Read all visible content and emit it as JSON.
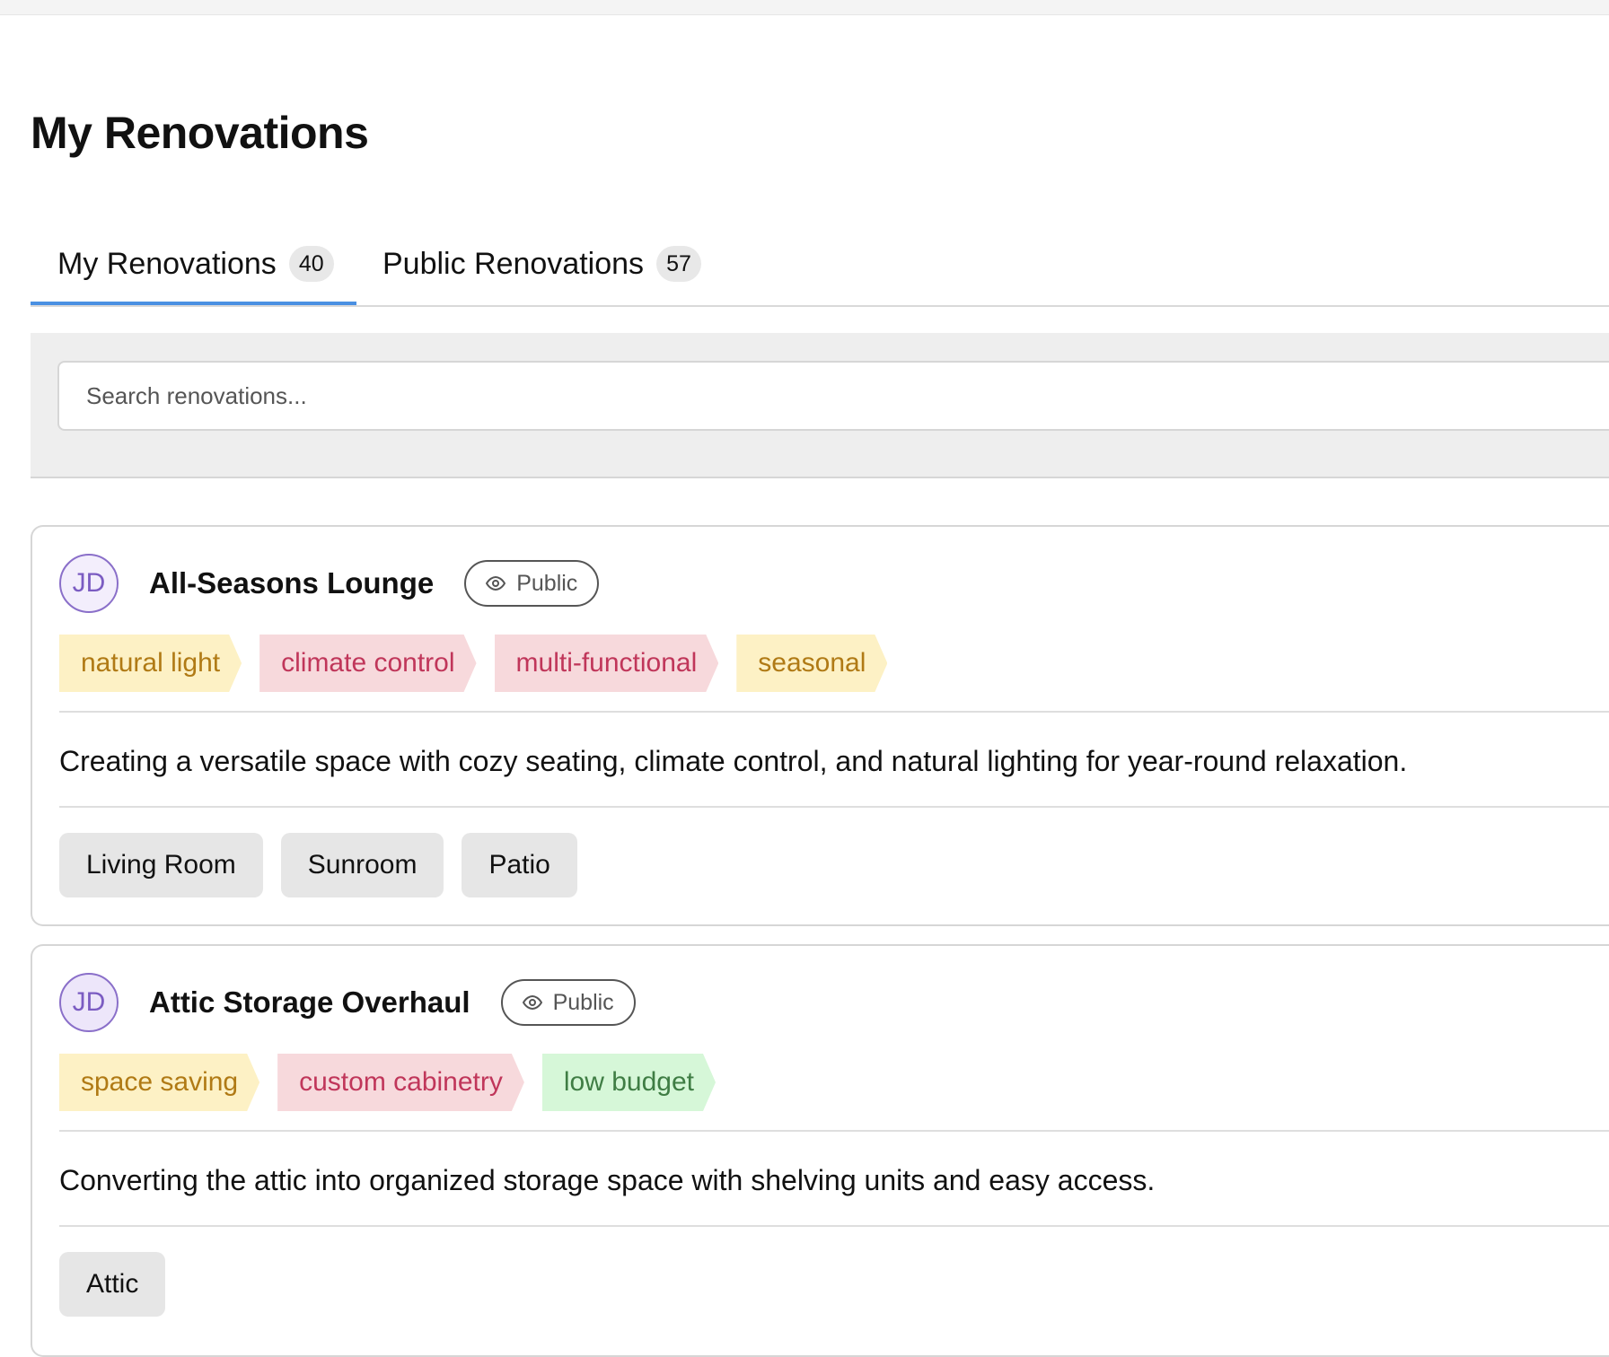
{
  "page": {
    "title": "My Renovations"
  },
  "tabs": [
    {
      "label": "My Renovations",
      "count": "40",
      "active": true
    },
    {
      "label": "Public Renovations",
      "count": "57",
      "active": false
    }
  ],
  "search": {
    "placeholder": "Search renovations...",
    "value": ""
  },
  "colors": {
    "accent": "#4a90e2",
    "avatar_border": "#8a6fc9",
    "tag_yellow_bg": "#fdf1c5",
    "tag_yellow_text": "#b07a15",
    "tag_pink_bg": "#f7d9dc",
    "tag_pink_text": "#c0365a",
    "tag_green_bg": "#d6f7d8",
    "tag_green_text": "#3f7d44"
  },
  "renovations": [
    {
      "owner_initials": "JD",
      "title": "All-Seasons Lounge",
      "visibility": "Public",
      "visibility_icon": "eye-icon",
      "tags": [
        {
          "label": "natural light",
          "color": "yellow"
        },
        {
          "label": "climate control",
          "color": "pink"
        },
        {
          "label": "multi-functional",
          "color": "pink"
        },
        {
          "label": "seasonal",
          "color": "yellow"
        }
      ],
      "description": "Creating a versatile space with cozy seating, climate control, and natural lighting for year-round relaxation.",
      "rooms": [
        "Living Room",
        "Sunroom",
        "Patio"
      ]
    },
    {
      "owner_initials": "JD",
      "title": "Attic Storage Overhaul",
      "visibility": "Public",
      "visibility_icon": "eye-icon",
      "tags": [
        {
          "label": "space saving",
          "color": "yellow"
        },
        {
          "label": "custom cabinetry",
          "color": "pink"
        },
        {
          "label": "low budget",
          "color": "green"
        }
      ],
      "description": "Converting the attic into organized storage space with shelving units and easy access.",
      "rooms": [
        "Attic"
      ]
    }
  ]
}
